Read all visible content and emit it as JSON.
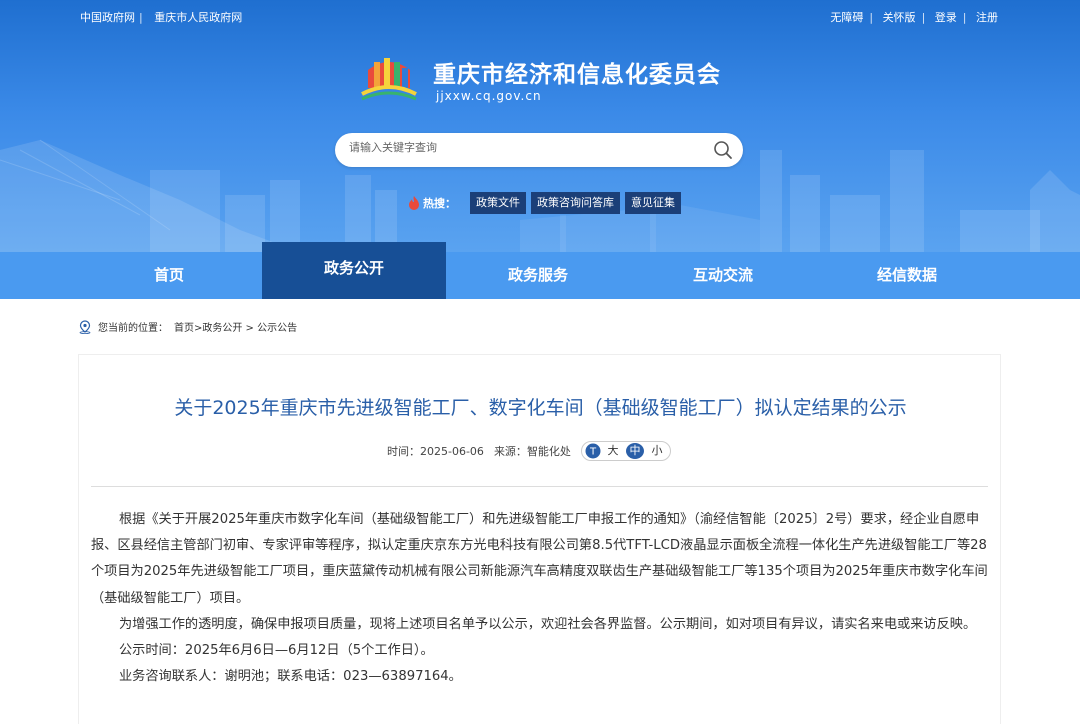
{
  "top_links": {
    "left": [
      "中国政府网",
      "重庆市人民政府网"
    ],
    "right": [
      "无障碍",
      "关怀版",
      "登录",
      "注册"
    ]
  },
  "site": {
    "title": "重庆市经济和信息化委员会",
    "domain": "jjxxw.cq.gov.cn"
  },
  "search": {
    "placeholder": "请输入关键字查询"
  },
  "hot": {
    "label": "热搜：",
    "tags": [
      "政策文件",
      "政策咨询问答库",
      "意见征集"
    ]
  },
  "nav": {
    "items": [
      "首页",
      "政务公开",
      "政务服务",
      "互动交流",
      "经信数据"
    ],
    "active_index": 1
  },
  "breadcrumb": {
    "prefix": "您当前的位置：",
    "path": "首页>政务公开 > 公示公告"
  },
  "article": {
    "title": "关于2025年重庆市先进级智能工厂、数字化车间（基础级智能工厂）拟认定结果的公示",
    "time_label": "时间：",
    "time": "2025-06-06",
    "source_label": "来源：",
    "source": "智能化处",
    "font_sizes": [
      "大",
      "中",
      "小"
    ],
    "font_size_selected": "中",
    "paragraphs": [
      "根据《关于开展2025年重庆市数字化车间（基础级智能工厂）和先进级智能工厂申报工作的通知》（渝经信智能〔2025〕2号）要求，经企业自愿申报、区县经信主管部门初审、专家评审等程序，拟认定重庆京东方光电科技有限公司第8.5代TFT-LCD液晶显示面板全流程一体化生产先进级智能工厂等28个项目为2025年先进级智能工厂项目，重庆蓝黛传动机械有限公司新能源汽车高精度双联齿生产基础级智能工厂等135个项目为2025年重庆市数字化车间（基础级智能工厂）项目。",
      "为增强工作的透明度，确保申报项目质量，现将上述项目名单予以公示，欢迎社会各界监督。公示期间，如对项目有异议，请实名来电或来访反映。",
      "公示时间：2025年6月6日—6月12日（5个工作日）。",
      "业务咨询联系人：谢明池；联系电话：023—63897164。"
    ]
  },
  "colors": {
    "header_blue": "#3b8ae8",
    "nav_blue": "#4a9af0",
    "nav_active": "#174f96",
    "title_blue": "#2a5fa8"
  }
}
